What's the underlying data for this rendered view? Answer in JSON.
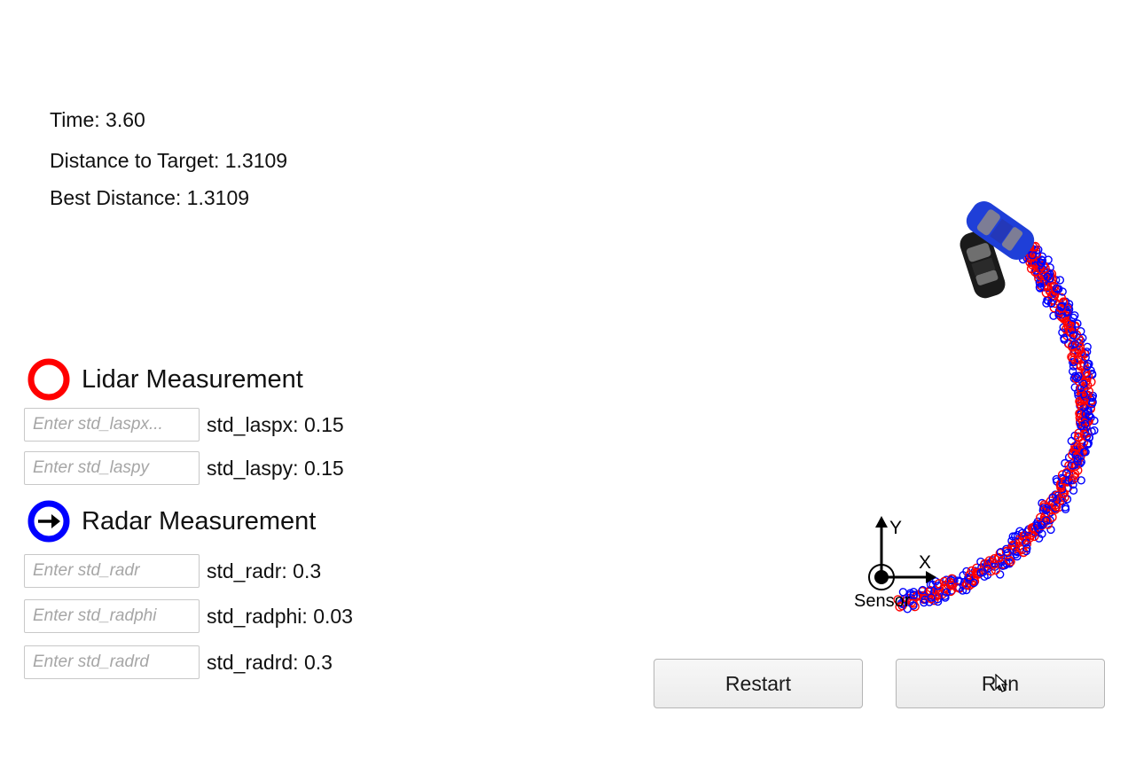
{
  "stats": {
    "time": "Time: 3.60",
    "distance": "Distance to Target: 1.3109",
    "best": "Best Distance: 1.3109"
  },
  "lidar": {
    "title": "Lidar Measurement",
    "color": "#ff0000",
    "fields": [
      {
        "placeholder": "Enter std_laspx...",
        "label": "std_laspx: 0.15"
      },
      {
        "placeholder": "Enter std_laspy",
        "label": "std_laspy: 0.15"
      }
    ]
  },
  "radar": {
    "title": "Radar Measurement",
    "color": "#0000ff",
    "fields": [
      {
        "placeholder": "Enter std_radr",
        "label": "std_radr: 0.3"
      },
      {
        "placeholder": "Enter std_radphi",
        "label": "std_radphi: 0.03"
      },
      {
        "placeholder": "Enter std_radrd",
        "label": "std_radrd: 0.3"
      }
    ]
  },
  "sensor": {
    "label": "Sensor",
    "x_axis": "X",
    "y_axis": "Y"
  },
  "buttons": {
    "restart": "Restart",
    "run": "Run"
  },
  "cars": {
    "target_color": "#1f3fd8",
    "ego_color": "#1a1a1a"
  }
}
